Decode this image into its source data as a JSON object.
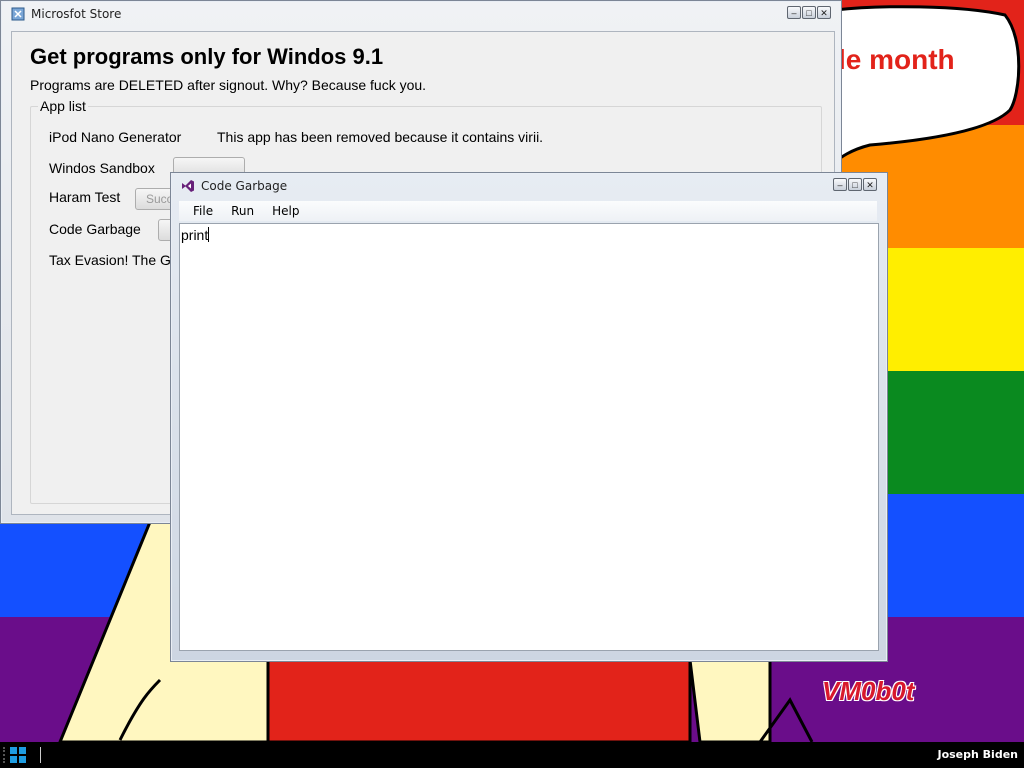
{
  "desktop": {
    "banner_text": "le month",
    "watermark": "VM0b0t",
    "rainbow": [
      "#e2231a",
      "#ff8c00",
      "#ffee00",
      "#0a8a1f",
      "#1450ff",
      "#6a0d8a"
    ]
  },
  "store_window": {
    "title": "Microsfot Store",
    "heading": "Get programs only for Windos 9.1",
    "subheading": "Programs are DELETED after signout. Why? Because fuck you.",
    "group_label": "App list",
    "apps": [
      {
        "name": "iPod Nano Generator",
        "desc": "This app has been removed because it contains virii."
      },
      {
        "name": "Windos Sandbox",
        "button": ""
      },
      {
        "name": "Haram Test",
        "button": "Succ"
      },
      {
        "name": "Code Garbage",
        "button": ""
      },
      {
        "name": "Tax Evasion! The G"
      }
    ]
  },
  "code_window": {
    "title": "Code Garbage",
    "menu": [
      "File",
      "Run",
      "Help"
    ],
    "editor_text": "print"
  },
  "taskbar": {
    "user": "Joseph Biden"
  }
}
